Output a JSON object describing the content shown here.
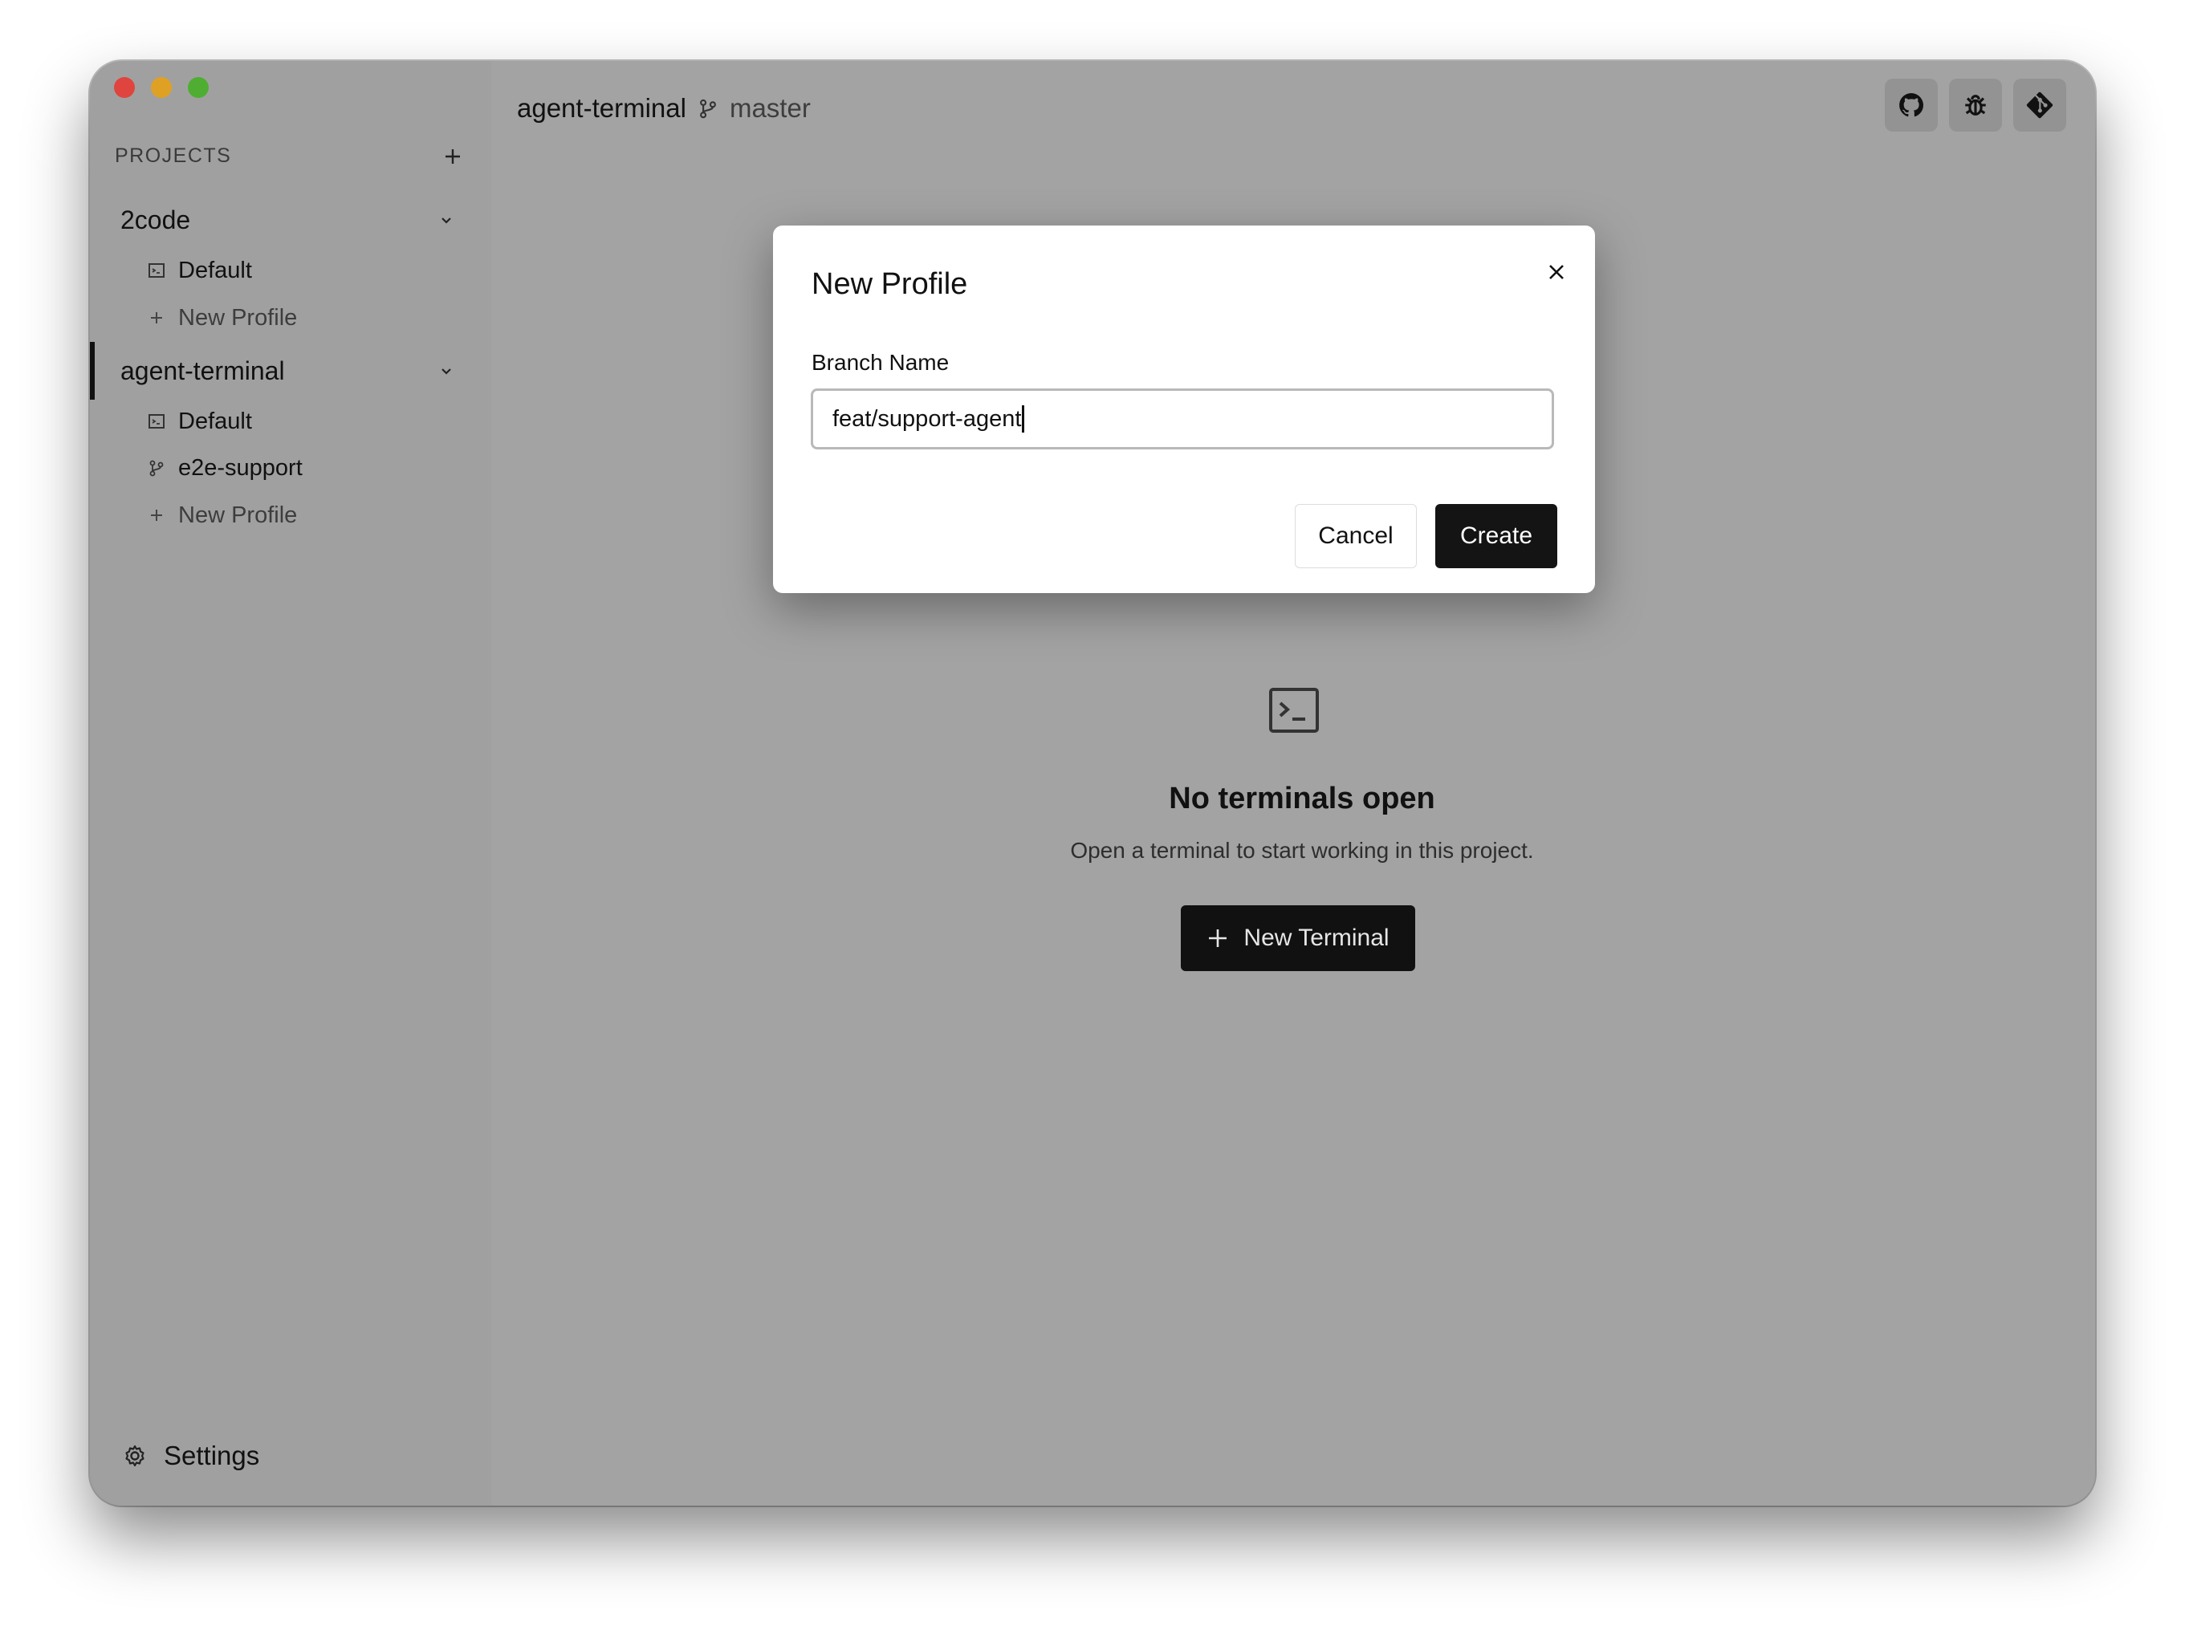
{
  "window": {
    "title": "agent-terminal"
  },
  "header": {
    "repo": "agent-terminal",
    "branch": "master"
  },
  "toolbar": {
    "icons": [
      "github-icon",
      "bug-icon",
      "git-icon"
    ]
  },
  "sidebar": {
    "section_title": "PROJECTS",
    "projects": [
      {
        "name": "2code",
        "items": [
          {
            "label": "Default",
            "icon": "terminal-icon"
          },
          {
            "label": "New Profile",
            "icon": "plus-icon"
          }
        ]
      },
      {
        "name": "agent-terminal",
        "items": [
          {
            "label": "Default",
            "icon": "terminal-icon"
          },
          {
            "label": "e2e-support",
            "icon": "branch-icon"
          },
          {
            "label": "New Profile",
            "icon": "plus-icon"
          }
        ]
      }
    ],
    "settings_label": "Settings"
  },
  "empty_state": {
    "title": "No terminals open",
    "subtitle": "Open a terminal to start working in this project.",
    "button_label": "New Terminal"
  },
  "modal": {
    "title": "New Profile",
    "field_label": "Branch Name",
    "field_value": "feat/support-agent",
    "cancel_label": "Cancel",
    "create_label": "Create"
  },
  "colors": {
    "primary": "#141414",
    "overlay": "#a3a3a3"
  }
}
